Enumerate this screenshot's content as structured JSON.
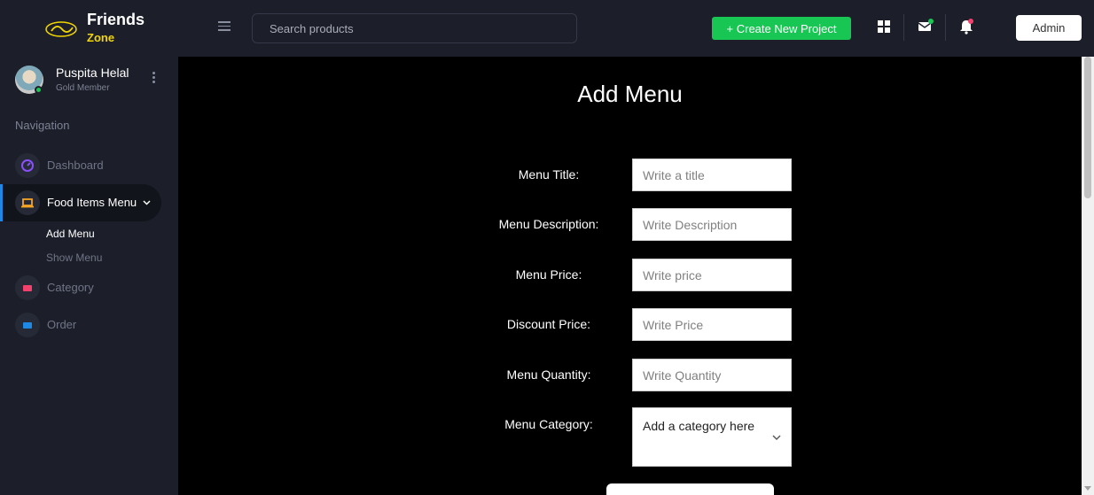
{
  "brand": {
    "name": "Friends",
    "subname": "Zone",
    "logo_text": "Friends"
  },
  "header": {
    "search_placeholder": "Search products",
    "create_label": "+ Create New Project",
    "admin_label": "Admin",
    "icons": [
      "grid-icon",
      "mail-icon",
      "bell-icon"
    ]
  },
  "user": {
    "name": "Puspita Helal",
    "role": "Gold Member"
  },
  "sidebar": {
    "heading": "Navigation",
    "items": [
      {
        "label": "Dashboard",
        "icon": "dashboard-icon",
        "color": "#8950fc"
      },
      {
        "label": "Food Items Menu",
        "icon": "laptop-icon",
        "color": "#f6a623"
      },
      {
        "label": "Category",
        "icon": "card-icon",
        "color": "#f1416c"
      },
      {
        "label": "Order",
        "icon": "card-icon",
        "color": "#1e88e5"
      }
    ],
    "subitems": [
      {
        "label": "Add Menu"
      },
      {
        "label": "Show Menu"
      }
    ]
  },
  "form": {
    "title": "Add Menu",
    "fields": [
      {
        "label": "Menu Title:",
        "placeholder": "Write a title"
      },
      {
        "label": "Menu Description:",
        "placeholder": "Write Description"
      },
      {
        "label": "Menu Price:",
        "placeholder": "Write price"
      },
      {
        "label": "Discount Price:",
        "placeholder": "Write Price"
      },
      {
        "label": "Menu Quantity:",
        "placeholder": "Write Quantity"
      }
    ],
    "category_label": "Menu Category:",
    "category_value": "Add a category here"
  },
  "colors": {
    "accent": "#17c653",
    "brand_yellow": "#f2d600",
    "active_bar": "#1e88e5"
  }
}
